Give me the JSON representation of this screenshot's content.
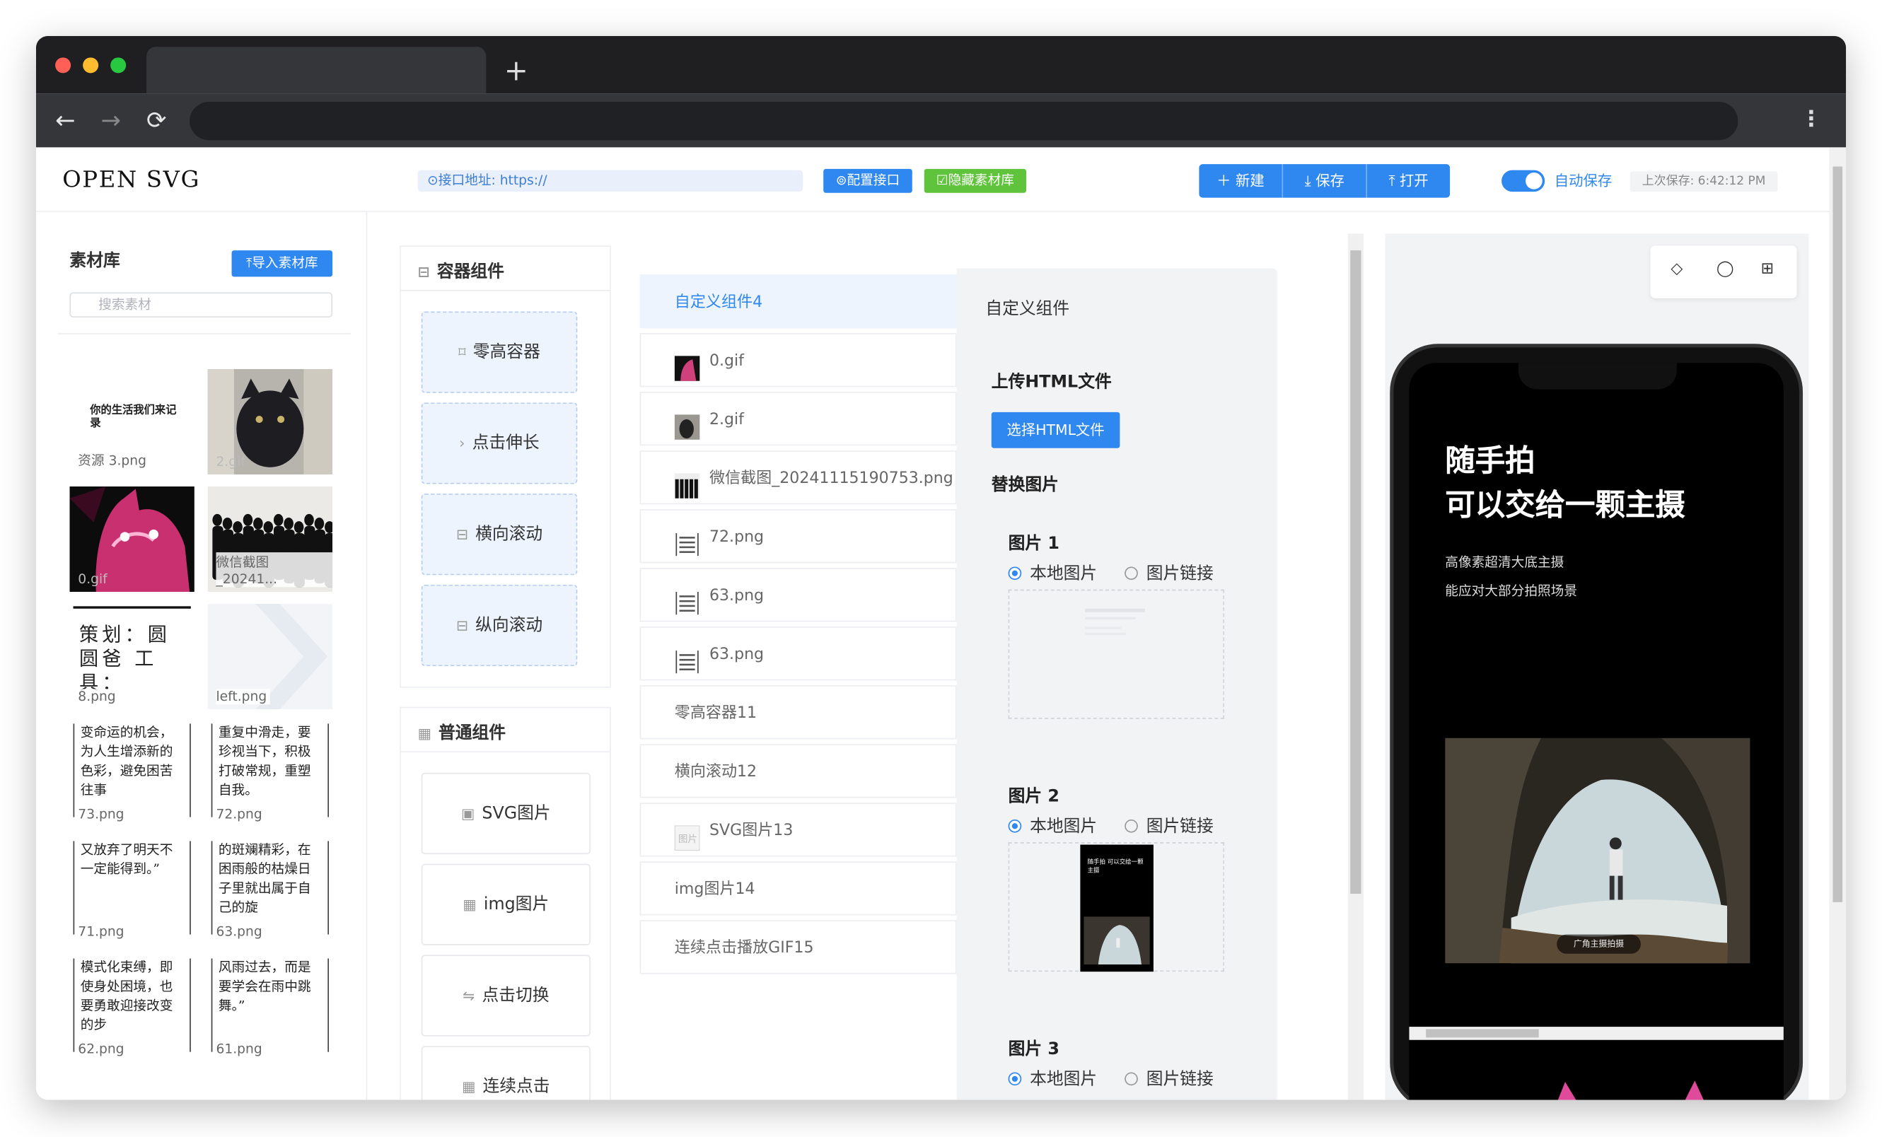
{
  "browser": {
    "new_tab": "+",
    "back": "←",
    "forward": "→",
    "reload": "⟳",
    "menu": "⋮"
  },
  "header": {
    "logo": "OPEN SVG",
    "api_address": "⊙接口地址: https://",
    "config_api": "⊚配置接口",
    "hide_library": "☑隐藏素材库",
    "new": "＋ 新建",
    "save": "⤓ 保存",
    "open": "⤒ 打开",
    "auto_save_label": "自动保存",
    "auto_save_on": true,
    "last_saved": "上次保存: 6:42:12 PM"
  },
  "library": {
    "title": "素材库",
    "import": "⤒导入素材库",
    "search_placeholder": "搜索素材",
    "items": [
      {
        "name": "资源 3.png",
        "text": "你的生活我们来记录"
      },
      {
        "name": "2.gif"
      },
      {
        "name": "0.gif"
      },
      {
        "name": "微信截图_20241..."
      },
      {
        "name": "8.png",
        "text": "策划：圆圆爸 工具：eDrop"
      },
      {
        "name": "left.png"
      },
      {
        "name": "73.png",
        "text": "变命运的机会，为人生增添新的色彩，避免困苦往事"
      },
      {
        "name": "72.png",
        "text": "重复中滑走，要珍视当下，积极打破常规，重塑自我。"
      },
      {
        "name": "71.png",
        "text": "又放弃了明天不一定能得到。”"
      },
      {
        "name": "63.png",
        "text": "的斑斓精彩，在困雨般的枯燥日子里就出属于自己的旋"
      },
      {
        "name": "62.png",
        "text": "模式化束缚，即使身处困境，也要勇敢迎接改变的步"
      },
      {
        "name": "61.png",
        "text": "风雨过去，而是要学会在雨中跳舞。”"
      }
    ]
  },
  "containers": {
    "title": "容器组件",
    "items": [
      {
        "icon": "⌑",
        "label": "零高容器"
      },
      {
        "icon": "›",
        "label": "点击伸长"
      },
      {
        "icon": "⊟",
        "label": "横向滚动"
      },
      {
        "icon": "⊟",
        "label": "纵向滚动"
      }
    ]
  },
  "normal": {
    "title": "普通组件",
    "items": [
      {
        "icon": "▣",
        "label": "SVG图片"
      },
      {
        "icon": "▦",
        "label": "img图片"
      },
      {
        "icon": "⇋",
        "label": "点击切换"
      },
      {
        "icon": "▦",
        "label": "连续点击"
      }
    ]
  },
  "layers": [
    {
      "label": "自定义组件4",
      "selected": true
    },
    {
      "label": "0.gif",
      "thumb": "pink"
    },
    {
      "label": "2.gif",
      "thumb": "gray"
    },
    {
      "label": "微信截图_20241115190753.png",
      "thumb": "crowd"
    },
    {
      "label": "72.png",
      "thumb": "text"
    },
    {
      "label": "63.png",
      "thumb": "text"
    },
    {
      "label": "63.png",
      "thumb": "text"
    },
    {
      "label": "零高容器11"
    },
    {
      "label": "横向滚动12"
    },
    {
      "label": "SVG图片13",
      "thumb": "svg"
    },
    {
      "label": "img图片14"
    },
    {
      "label": "连续点击播放GIF15"
    }
  ],
  "properties": {
    "title": "自定义组件",
    "upload_title": "上传HTML文件",
    "select_html": "选择HTML文件",
    "replace_title": "替换图片",
    "images": [
      {
        "label": "图片 1",
        "local": "本地图片",
        "link": "图片链接"
      },
      {
        "label": "图片 2",
        "local": "本地图片",
        "link": "图片链接"
      },
      {
        "label": "图片 3",
        "local": "本地图片",
        "link": "图片链接"
      }
    ]
  },
  "preview": {
    "tools": [
      "◇",
      "◯",
      "⊞"
    ],
    "headline1": "随手拍",
    "headline2": "可以交给一颗主摄",
    "sub1": "高像素超清大底主摄",
    "sub2": "能应对大部分拍照场景",
    "badge": "广角主摄拍摄",
    "mini_title": "随手拍 可以交给一颗主摄"
  }
}
